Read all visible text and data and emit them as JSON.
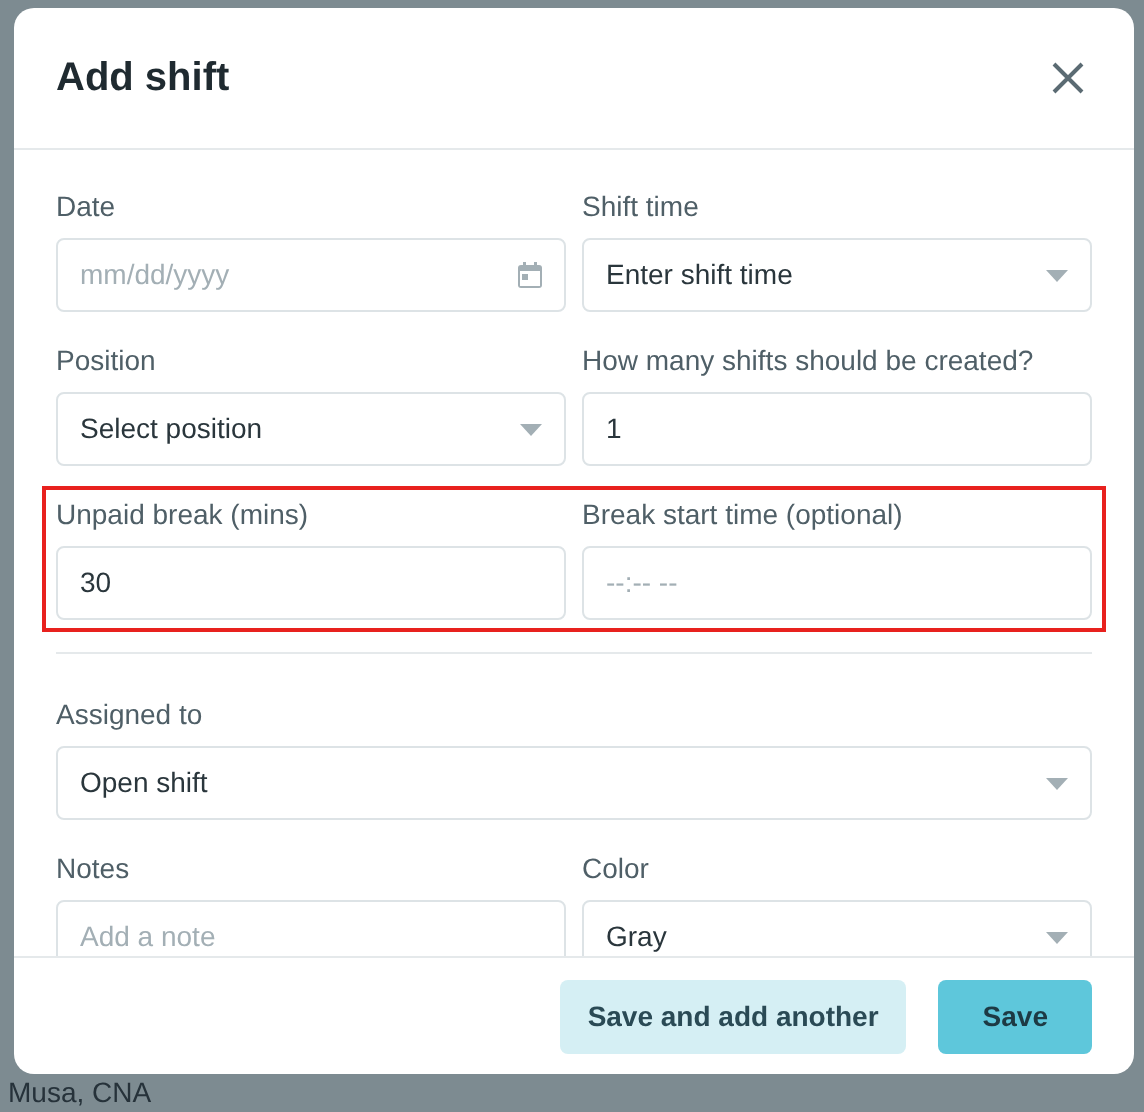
{
  "background": {
    "text": "Musa, CNA"
  },
  "modal": {
    "title": "Add shift",
    "rows": [
      {
        "highlighted": false,
        "divider_before": false,
        "fields": [
          {
            "label": "Date",
            "kind": "date",
            "placeholder": "mm/dd/yyyy"
          },
          {
            "label": "Shift time",
            "kind": "select",
            "value": "Enter shift time"
          }
        ]
      },
      {
        "highlighted": false,
        "divider_before": false,
        "fields": [
          {
            "label": "Position",
            "kind": "select",
            "value": "Select position"
          },
          {
            "label": "How many shifts should be created?",
            "kind": "text",
            "value": "1"
          }
        ]
      },
      {
        "highlighted": true,
        "divider_before": false,
        "fields": [
          {
            "label": "Unpaid break (mins)",
            "kind": "text",
            "value": "30"
          },
          {
            "label": "Break start time (optional)",
            "kind": "text",
            "placeholder": "--:-- --"
          }
        ]
      },
      {
        "highlighted": false,
        "divider_before": true,
        "fields": [
          {
            "label": "Assigned to",
            "kind": "select",
            "value": "Open shift"
          }
        ]
      },
      {
        "highlighted": false,
        "divider_before": false,
        "fields": [
          {
            "label": "Notes",
            "kind": "text",
            "placeholder": "Add a note"
          },
          {
            "label": "Color",
            "kind": "select",
            "value": "Gray"
          }
        ]
      }
    ],
    "buttons": [
      {
        "label": "Save and add another",
        "kind": "secondary"
      },
      {
        "label": "Save",
        "kind": "primary"
      }
    ]
  }
}
